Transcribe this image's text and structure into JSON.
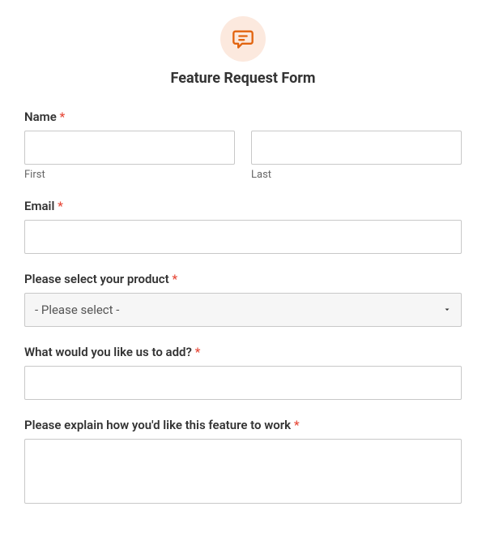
{
  "form": {
    "title": "Feature Request Form",
    "name_label": "Name",
    "name_first_sub": "First",
    "name_last_sub": "Last",
    "email_label": "Email",
    "product_label": "Please select your product",
    "product_placeholder": "- Please select -",
    "feature_add_label": "What would you like us to add?",
    "feature_explain_label": "Please explain how you'd like this feature to work",
    "required_mark": "*"
  }
}
